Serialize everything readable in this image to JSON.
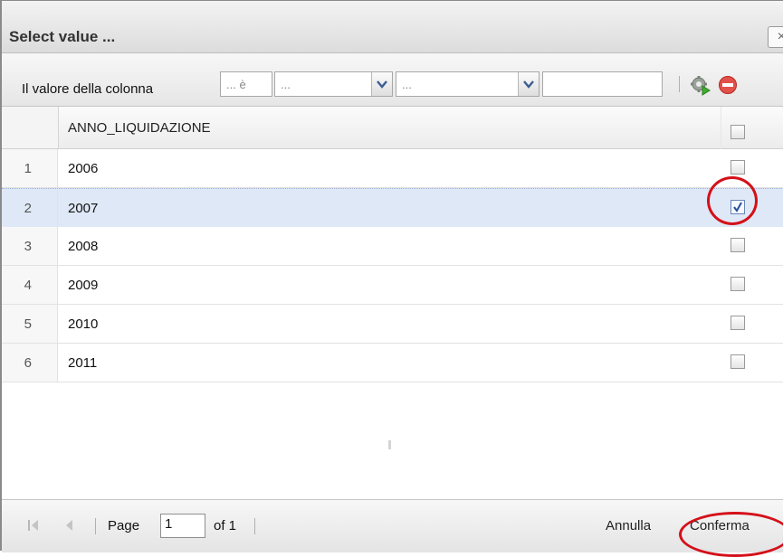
{
  "window": {
    "title": "Select value ...",
    "close_glyph": "×"
  },
  "toolbar": {
    "label": "Il valore della colonna",
    "operator_value": "... è",
    "combo1_value": "...",
    "combo2_value": "...",
    "text_value": "",
    "icons": [
      "settings-gear-icon",
      "remove-minus-icon"
    ]
  },
  "grid": {
    "column_header": "ANNO_LIQUIDAZIONE",
    "rows": [
      {
        "num": "1",
        "value": "2006",
        "checked": false
      },
      {
        "num": "2",
        "value": "2007",
        "checked": true
      },
      {
        "num": "3",
        "value": "2008",
        "checked": false
      },
      {
        "num": "4",
        "value": "2009",
        "checked": false
      },
      {
        "num": "5",
        "value": "2010",
        "checked": false
      },
      {
        "num": "6",
        "value": "2011",
        "checked": false
      }
    ]
  },
  "pager": {
    "page_label": "Page",
    "page_value": "1",
    "of_label": "of 1",
    "cancel_label": "Annulla",
    "confirm_label": "Conferma"
  },
  "colors": {
    "highlight": "#d4101a",
    "selected_row": "#dfe8f6"
  }
}
